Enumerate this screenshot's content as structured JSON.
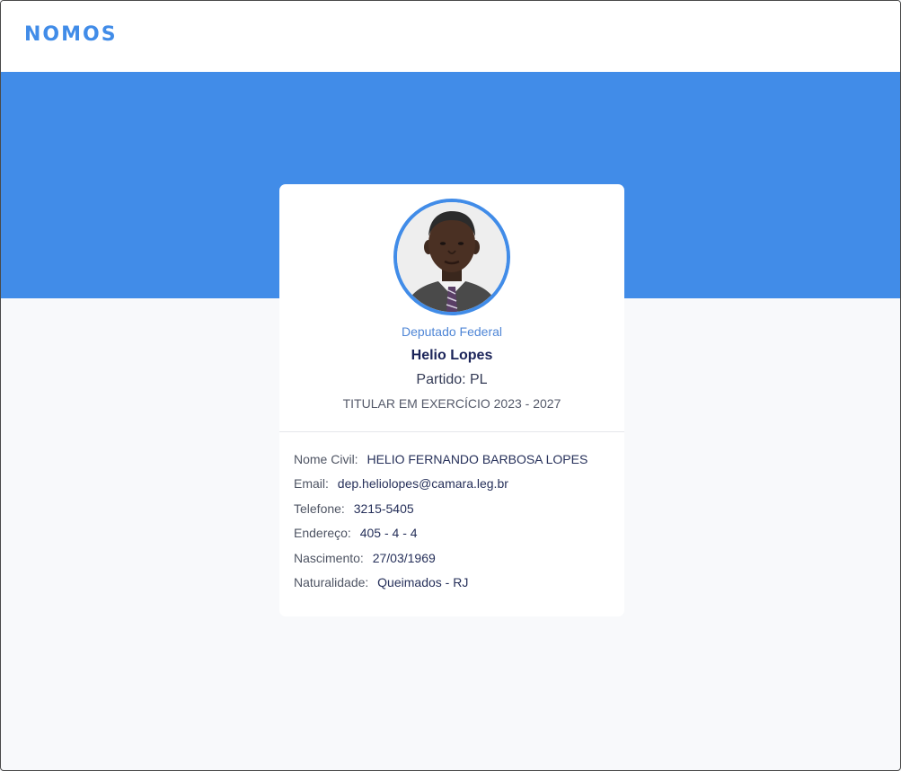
{
  "app": {
    "logo": "NOMOS"
  },
  "profile": {
    "role": "Deputado Federal",
    "name": "Helio Lopes",
    "party": "Partido: PL",
    "term": "TITULAR EM EXERCÍCIO 2023 - 2027"
  },
  "details": [
    {
      "label": "Nome Civil:",
      "value": "HELIO FERNANDO BARBOSA LOPES"
    },
    {
      "label": "Email:",
      "value": "dep.heliolopes@camara.leg.br"
    },
    {
      "label": "Telefone:",
      "value": "3215-5405"
    },
    {
      "label": "Endereço:",
      "value": " 405 - 4 - 4"
    },
    {
      "label": "Nascimento:",
      "value": "27/03/1969"
    },
    {
      "label": "Naturalidade:",
      "value": "Queimados - RJ"
    }
  ],
  "colors": {
    "accent": "#418ce8",
    "page_background": "#f8f9fb",
    "name_text": "#1b2459"
  }
}
